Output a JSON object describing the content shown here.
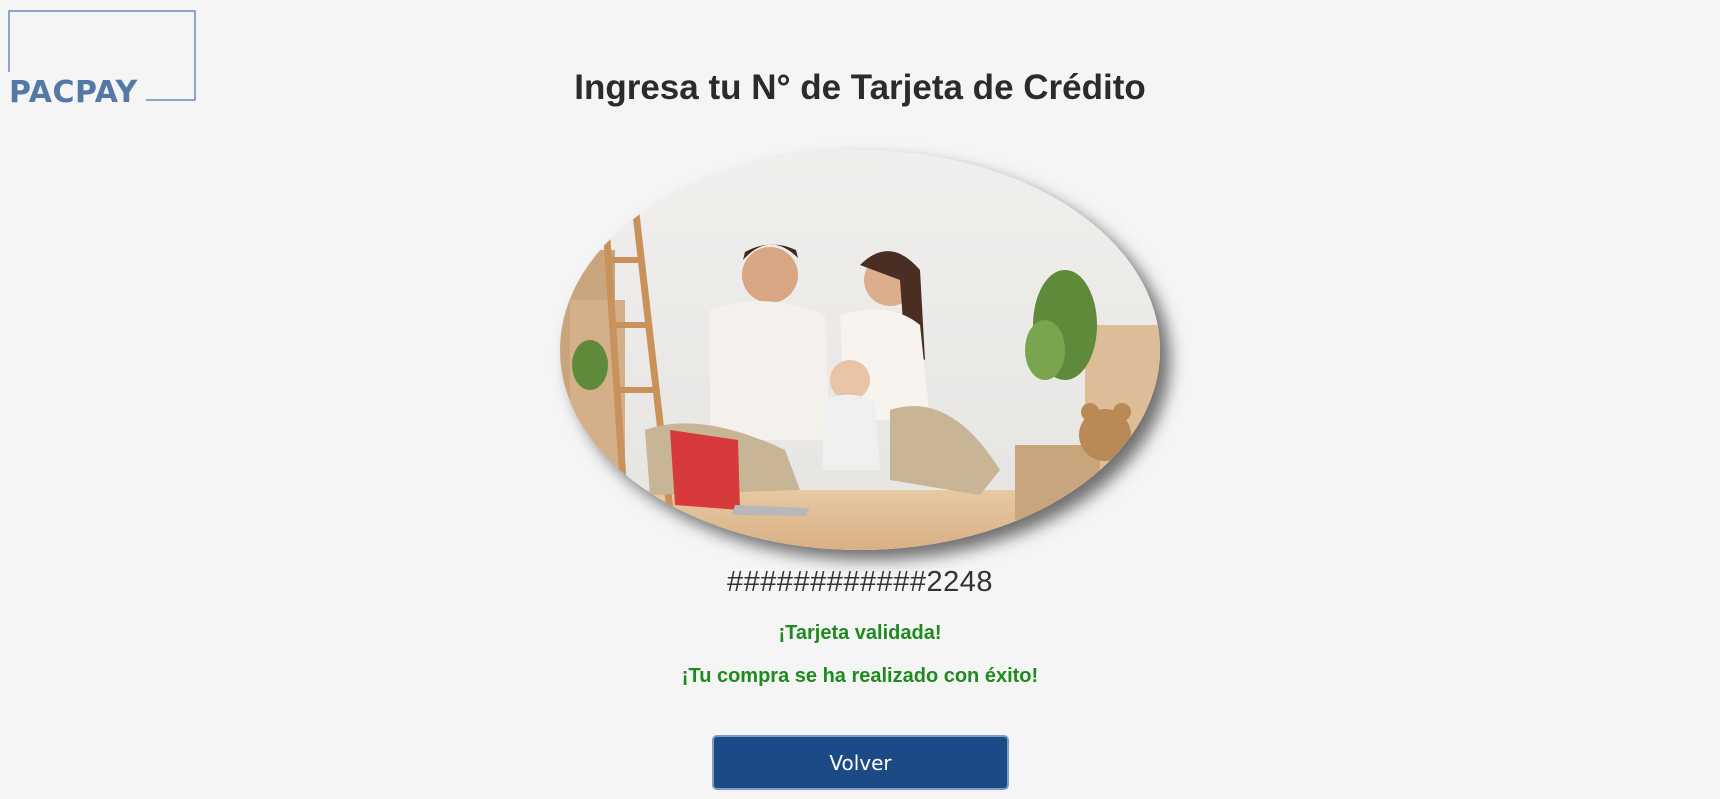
{
  "brand": {
    "logo_text": "PACPAY",
    "logo_color": "#5479a7"
  },
  "header": {
    "title": "Ingresa tu N° de Tarjeta de Crédito"
  },
  "card": {
    "masked_number": "############2248"
  },
  "status": {
    "validated": "¡Tarjeta validada!",
    "success": "¡Tu compra se ha realizado con éxito!",
    "color": "#1f8a1f"
  },
  "actions": {
    "back_label": "Volver",
    "button_color": "#1c4a86"
  }
}
